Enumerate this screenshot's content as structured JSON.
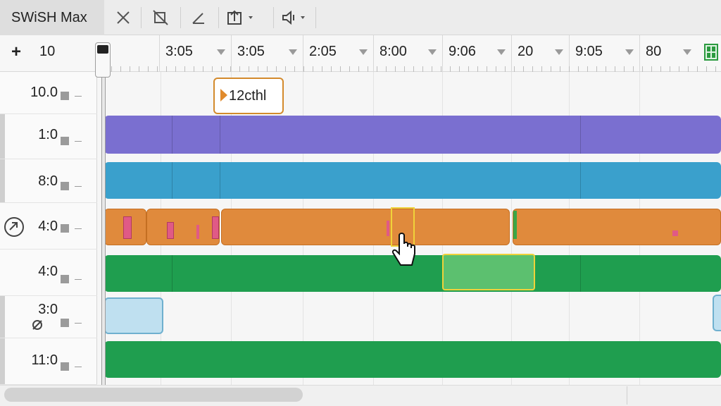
{
  "app": {
    "title": "SWiSH Max"
  },
  "toolbar": {
    "tools": [
      {
        "name": "close-icon"
      },
      {
        "name": "no-bounds-icon"
      },
      {
        "name": "angle-icon"
      },
      {
        "name": "export-dropdown-icon"
      },
      {
        "name": "sound-dropdown-icon"
      }
    ]
  },
  "ruler": {
    "add_label": "+",
    "zoom_value": "10",
    "ticks": [
      "3:05",
      "3:05",
      "2:05",
      "8:00",
      "9:06",
      "20",
      "9:05",
      "80"
    ]
  },
  "tracks": [
    {
      "label": "10.0",
      "color": ""
    },
    {
      "label": "1:0",
      "color": "#7a6fd0"
    },
    {
      "label": "8:0",
      "color": "#3aa0cc"
    },
    {
      "label": "4:0",
      "color": "#e08a3c",
      "icon": "link-icon"
    },
    {
      "label": "4:0",
      "color": "#1f9e4f"
    },
    {
      "label": "3:0",
      "color": "#bfe0f0",
      "icon": "hidden-icon"
    },
    {
      "label": "11:0",
      "color": "#1f9e4f"
    }
  ],
  "marker": {
    "label": "12cthl"
  },
  "colors": {
    "purple": "#7a6fd0",
    "blue": "#3aa0cc",
    "orange": "#e08a3c",
    "green": "#1f9e4f",
    "light_green": "#5cc06f",
    "light_blue": "#bfe0f0",
    "pink": "#e05a86",
    "selection": "#f0d23a"
  }
}
